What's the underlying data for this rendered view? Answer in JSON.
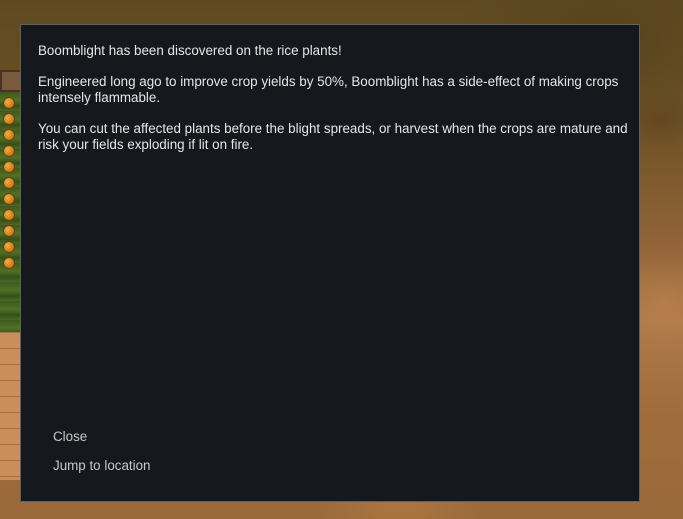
{
  "letter": {
    "paragraphs": [
      "Boomblight has been discovered on the rice plants!",
      "Engineered long ago to improve crop yields by 50%, Boomblight has a side-effect of making crops intensely flammable.",
      "You can cut the affected plants before the blight spreads, or harvest when the crops are mature and risk your fields exploding if lit on fire."
    ],
    "options": {
      "close": "Close",
      "jump": "Jump to location"
    }
  }
}
